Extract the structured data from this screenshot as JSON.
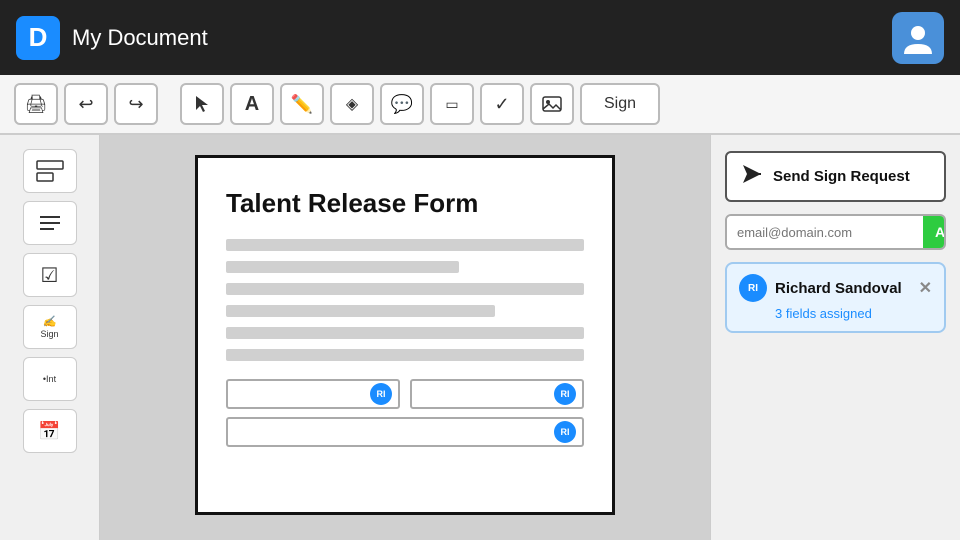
{
  "header": {
    "logo_text": "D",
    "title": "My Document",
    "avatar_icon": "👤"
  },
  "toolbar": {
    "buttons": [
      {
        "name": "print",
        "icon": "🖨",
        "label": "Print"
      },
      {
        "name": "undo",
        "icon": "↩",
        "label": "Undo"
      },
      {
        "name": "redo",
        "icon": "↪",
        "label": "Redo"
      },
      {
        "name": "select",
        "icon": "↖",
        "label": "Select"
      },
      {
        "name": "text",
        "icon": "A",
        "label": "Text"
      },
      {
        "name": "pen",
        "icon": "✏",
        "label": "Pen"
      },
      {
        "name": "highlighter",
        "icon": "◈",
        "label": "Highlighter"
      },
      {
        "name": "comment",
        "icon": "💬",
        "label": "Comment"
      },
      {
        "name": "eraser",
        "icon": "▭",
        "label": "Eraser"
      },
      {
        "name": "checkmark",
        "icon": "✓",
        "label": "Checkmark"
      },
      {
        "name": "image",
        "icon": "🖼",
        "label": "Image"
      }
    ],
    "sign_label": "Sign"
  },
  "left_sidebar": {
    "tools": [
      {
        "name": "text-align",
        "icon": "▤",
        "label": "Text Align"
      },
      {
        "name": "list",
        "icon": "☰",
        "label": "List"
      },
      {
        "name": "checkbox",
        "icon": "☑",
        "label": "Checkbox"
      },
      {
        "name": "signature",
        "icon": "✍ Sign",
        "label": "Signature"
      },
      {
        "name": "initial",
        "icon": "Int",
        "label": "Initial"
      },
      {
        "name": "date",
        "icon": "📅",
        "label": "Date"
      }
    ]
  },
  "document": {
    "title": "Talent Release Form",
    "lines": [
      {
        "type": "full"
      },
      {
        "type": "medium"
      },
      {
        "type": "full"
      },
      {
        "type": "short"
      },
      {
        "type": "full"
      },
      {
        "type": "full"
      }
    ]
  },
  "right_sidebar": {
    "send_sign_label": "Send Sign Request",
    "email_placeholder": "email@domain.com",
    "add_label": "Add",
    "recipient": {
      "initials": "RI",
      "name": "Richard Sandoval",
      "fields_label": "3 fields assigned"
    }
  }
}
